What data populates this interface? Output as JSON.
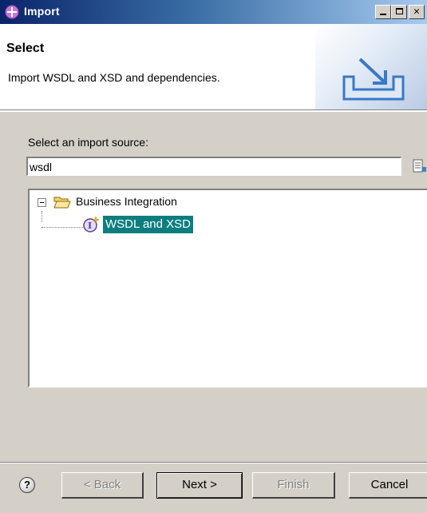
{
  "window": {
    "title": "Import"
  },
  "header": {
    "title": "Select",
    "description": "Import WSDL and XSD and dependencies."
  },
  "source": {
    "label": "Select an import source:",
    "filter_value": "wsdl"
  },
  "tree": {
    "parent_label": "Business Integration",
    "child_label": "WSDL and XSD",
    "selected_color": "#0d7e80"
  },
  "footer": {
    "help": "?",
    "back_label": "< Back",
    "next_label": "Next >",
    "finish_label": "Finish",
    "cancel_label": "Cancel"
  },
  "colors": {
    "titlebar_start": "#0a246a",
    "dialog_bg": "#d4d0c8",
    "selection": "#0d7e80"
  }
}
